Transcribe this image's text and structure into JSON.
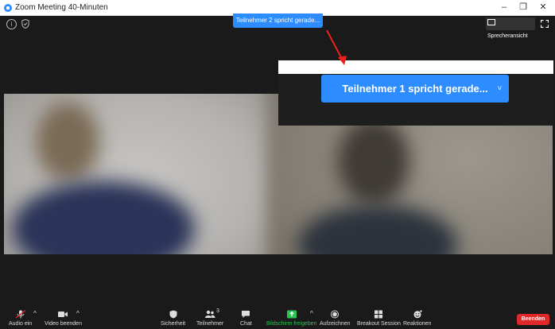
{
  "window": {
    "title": "Zoom Meeting 40-Minuten",
    "minimize": "–",
    "restore": "❐",
    "close": "✕"
  },
  "header": {
    "speaking_notice": "Teilnehmer 2 spricht gerade...",
    "speaker_view_label": "Sprecheransicht"
  },
  "overlay": {
    "speaking_notice": "Teilnehmer 1 spricht gerade...",
    "more": "˅"
  },
  "toolbar": {
    "audio_label": "Audio ein",
    "video_label": "Video beenden",
    "security_label": "Sicherheit",
    "participants_label": "Teilnehmer",
    "participants_count": "3",
    "chat_label": "Chat",
    "share_label": "Bildschirm freigeben",
    "record_label": "Aufzeichnen",
    "breakout_label": "Breakout Session",
    "reactions_label": "Reaktionen",
    "end_label": "Beenden",
    "chevron": "^"
  },
  "colors": {
    "accent": "#2d8cff",
    "share_green": "#2bc352",
    "end_red": "#e02828",
    "background": "#1a1a1a",
    "arrow": "#e8211c"
  }
}
